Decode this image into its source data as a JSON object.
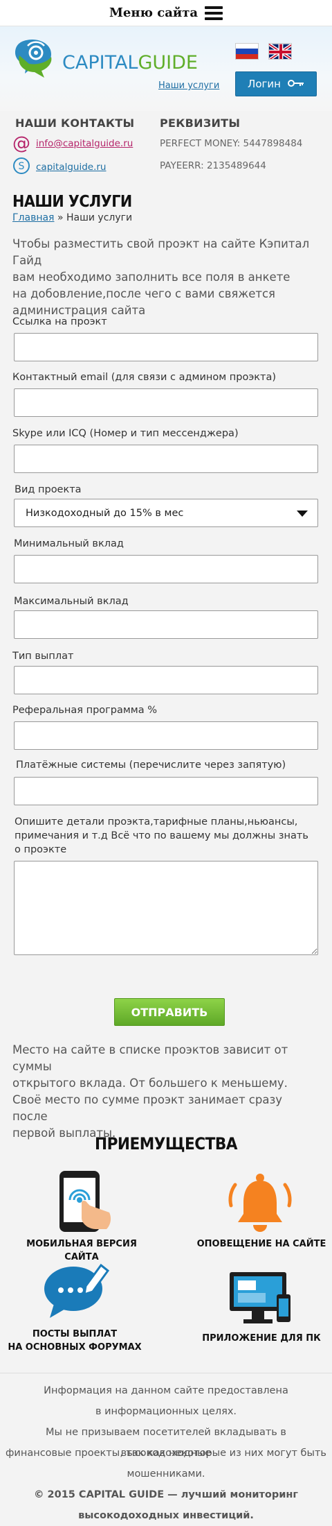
{
  "topbar": {
    "menu_label": "Меню сайта"
  },
  "header": {
    "logo_capital": "CAPITAL",
    "logo_guide": "GUIDE",
    "services_link": "Наши услуги",
    "login_label": "Логин"
  },
  "contacts": {
    "heading": "НАШИ КОНТАКТЫ",
    "email": "info@capitalguide.ru",
    "skype": "capitalguide.ru",
    "req_heading": "РЕКВИЗИТЫ",
    "perfect_money": "PERFECT MONEY: 5447898484",
    "payeer": "PAYEERR: 2135489644"
  },
  "page": {
    "title": "НАШИ УСЛУГИ",
    "crumb_home": "Главная",
    "crumb_sep": "»",
    "crumb_current": "Наши услуги",
    "intro_1": "Чтобы разместить свой проэкт на сайте Кэпитал Гайд",
    "intro_2": "вам необходимо заполнить все поля в анкете",
    "intro_3": "на добовление,после чего с вами свяжется",
    "intro_4": "администрация сайта"
  },
  "form": {
    "project_link_label": "Ссылка на проэкт",
    "project_link_value": "",
    "email_label": "Контактный email (для связи с админом проэкта)",
    "email_value": "",
    "skype_label": "Skype или ICQ (Номер и тип мессенджера)",
    "skype_value": "",
    "type_label": "Вид проекта",
    "type_selected": "Низкодоходный до 15% в мес",
    "min_label": "Минимальный вклад",
    "min_value": "",
    "max_label": "Максимальный вклад",
    "max_value": "",
    "payout_label": "Тип выплат",
    "payout_value": "",
    "ref_label": "Реферальная программа %",
    "ref_value": "",
    "pay_systems_label": "Платёжные системы (перечислите через запятую)",
    "pay_systems_value": "",
    "details_label_1": "Опишите детали проэкта,тарифные планы,ньюансы,",
    "details_label_2": "примечания и т.д  Всё что по вашему мы должны знать",
    "details_label_3": "о проэкте",
    "details_value": "",
    "submit_label": "ОТПРАВИТЬ"
  },
  "note": {
    "line_1": "Место на сайте в списке проэктов зависит от суммы",
    "line_2": "открытого вклада. От большего к меньшему.",
    "line_3": "Своё место по сумме проэкт занимает сразу после",
    "line_4": "первой выплаты."
  },
  "advantages": {
    "title": "ПРИЕМУЩЕСТВА",
    "mobile": "МОБИЛЬНАЯ ВЕРСИЯ САЙТА",
    "notify": "ОПОВЕЩЕНИЕ НА САЙТЕ",
    "posts_1": "ПОСТЫ ВЫПЛАТ",
    "posts_2": "НА ОСНОВНЫХ ФОРУМАХ",
    "pc_app": "ПРИЛОЖЕНИЕ ДЛЯ ПК"
  },
  "footer": {
    "line_1": "Информация на данном сайте предоставлена",
    "line_2": "в информационных целях.",
    "line_3": "Мы не призываем посетителей вкладывать в высокодоходные",
    "line_4": "финансовые проекты, так как некоторые из них могут быть",
    "line_5": "мошенниками.",
    "copy_1": "© 2015 CAPITAL GUIDE — лучший мониторинг",
    "copy_2": "высокодоходных инвестиций."
  },
  "colors": {
    "brand_blue": "#2d8bc2",
    "brand_green": "#5fae2a",
    "submit_green": "#6cb52f",
    "accent_blue": "#1f7fb6"
  }
}
